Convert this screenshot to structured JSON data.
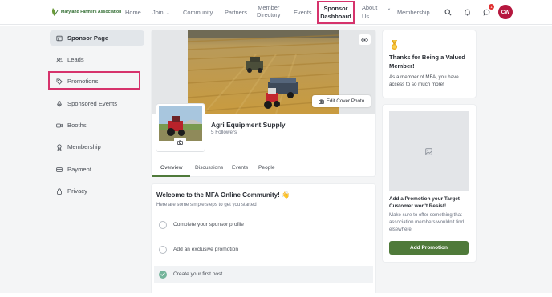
{
  "header": {
    "logo_text": "Maryland Farmers Association",
    "nav": {
      "home": "Home",
      "join": "Join",
      "community": "Community",
      "partners": "Partners",
      "member_directory_line1": "Member",
      "member_directory_line2": "Directory",
      "events": "Events",
      "sponsor_line1": "Sponsor",
      "sponsor_line2": "Dashboard",
      "about_line1": "About",
      "about_line2": "Us",
      "membership": "Membership"
    },
    "notification_count": "1",
    "avatar_initials": "CW"
  },
  "sidebar": {
    "items": [
      {
        "label": "Sponsor Page"
      },
      {
        "label": "Leads"
      },
      {
        "label": "Promotions"
      },
      {
        "label": "Sponsored Events"
      },
      {
        "label": "Booths"
      },
      {
        "label": "Membership"
      },
      {
        "label": "Payment"
      },
      {
        "label": "Privacy"
      }
    ]
  },
  "profile": {
    "edit_cover_label": "Edit Cover Photo",
    "company_name": "Agri Equipment Supply",
    "followers": "5 Followers",
    "tabs": [
      "Overview",
      "Discussions",
      "Events",
      "People"
    ]
  },
  "welcome": {
    "title": "Welcome to the MFA Online Community! 👋",
    "subtitle": "Here are some simple steps to get you started",
    "steps": [
      {
        "label": "Complete your sponsor profile",
        "done": false
      },
      {
        "label": "Add an exclusive promotion",
        "done": false
      },
      {
        "label": "Create your first post",
        "done": true
      }
    ]
  },
  "thanks_card": {
    "title": "Thanks for Being a Valued Member!",
    "body": "As a member of MFA, you have access to so much more!"
  },
  "promo_card": {
    "title": "Add a Promotion your Target Customer won't Resist!",
    "body": "Make sure to offer something that association members wouldn't find elsewhere.",
    "button": "Add Promotion"
  },
  "colors": {
    "brand_green": "#4f7a3a",
    "highlight": "#d6336c",
    "avatar": "#b5173e"
  }
}
